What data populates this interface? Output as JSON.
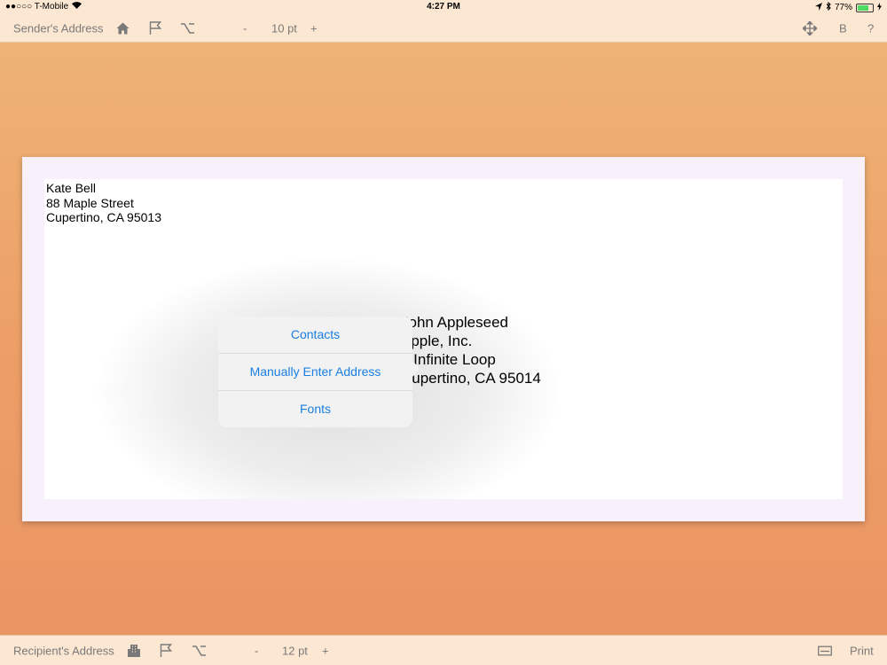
{
  "status_bar": {
    "carrier": "●●○○○ T-Mobile",
    "time": "4:27 PM",
    "battery": "77%",
    "battery_level": 0.77
  },
  "top_toolbar": {
    "label": "Sender's Address",
    "icons": [
      "home-icon",
      "flag-icon",
      "option-key-icon"
    ],
    "decrease": "-",
    "font_size": "10 pt",
    "increase": "+",
    "right_icons": [
      "move-icon"
    ],
    "bold": "B",
    "help": "?"
  },
  "sender": {
    "lines": [
      "Kate Bell",
      "88 Maple Street",
      "Cupertino, CA 95013"
    ]
  },
  "recipient": {
    "lines": [
      "John Appleseed",
      "Apple, Inc.",
      "1 Infinite Loop",
      "Cupertino, CA 95014"
    ]
  },
  "popover": {
    "items": [
      "Contacts",
      "Manually Enter Address",
      "Fonts"
    ],
    "accent_color": "#1a7fe0"
  },
  "bottom_toolbar": {
    "label": "Recipient's Address",
    "icons": [
      "building-icon",
      "flag-icon",
      "option-key-icon"
    ],
    "decrease": "-",
    "font_size": "12 pt",
    "increase": "+",
    "right_icons": [
      "envelope-size-icon"
    ],
    "print": "Print"
  }
}
